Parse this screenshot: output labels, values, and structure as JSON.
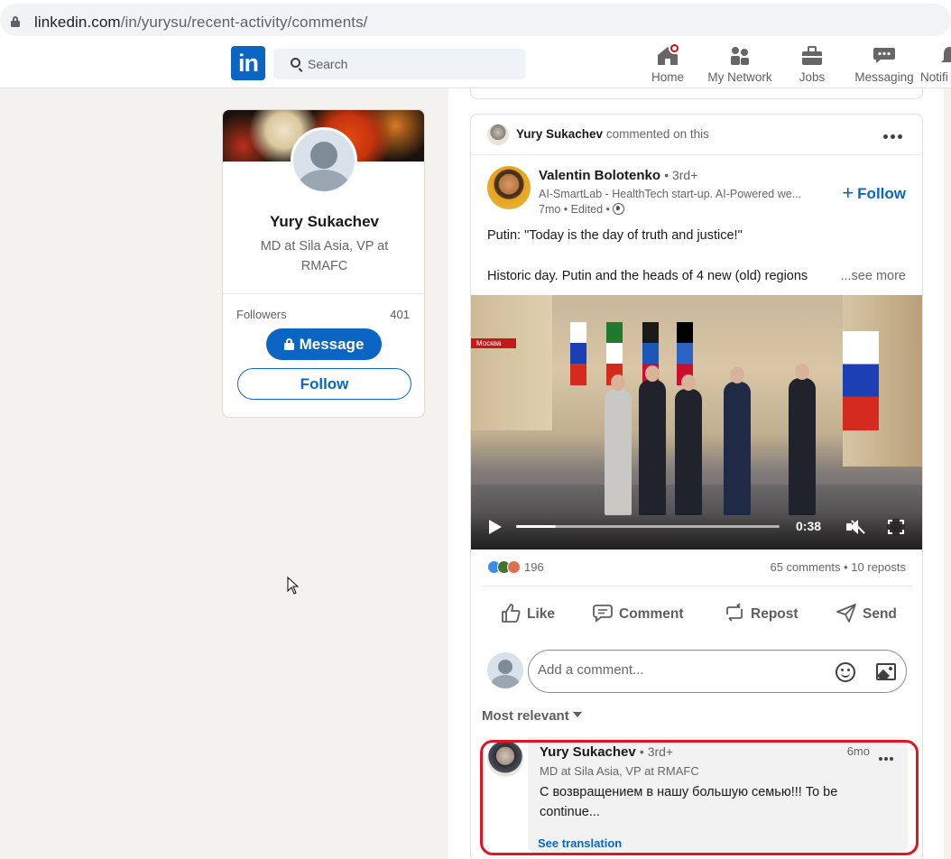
{
  "browser": {
    "url_host": "linkedin.com",
    "url_path": "/in/yurysu/recent-activity/comments/"
  },
  "nav": {
    "logo": "in",
    "search_placeholder": "Search",
    "items": [
      {
        "label": "Home",
        "icon": "home-icon",
        "badge": true
      },
      {
        "label": "My Network",
        "icon": "network-icon"
      },
      {
        "label": "Jobs",
        "icon": "briefcase-icon"
      },
      {
        "label": "Messaging",
        "icon": "messaging-icon"
      },
      {
        "label": "Notifi",
        "icon": "bell-icon"
      }
    ]
  },
  "profile_card": {
    "name": "Yury Sukachev",
    "title": "MD at Sila Asia, VP at RMAFC",
    "followers_label": "Followers",
    "followers_count": "401",
    "message_button": "Message",
    "follow_button": "Follow"
  },
  "post": {
    "activity_actor": "Yury Sukachev",
    "activity_text": "commented on this",
    "author_name": "Valentin Bolotenko",
    "author_degree": "• 3rd+",
    "author_headline": "AI-SmartLab - HealthTech start-up. AI-Powered we...",
    "author_meta": "7mo • Edited •",
    "follow_label": "Follow",
    "text_line1": "Putin: \"Today is the day of truth and justice!\"",
    "text_line2": "Historic day. Putin and the heads of 4 new (old) regions",
    "see_more": "...see more",
    "video": {
      "overlay_tag": "Москва",
      "time": "0:38",
      "progress": 0.15,
      "muted": true
    },
    "reactions_count": "196",
    "comments_reposts": "65 comments • 10 reposts",
    "actions": [
      "Like",
      "Comment",
      "Repost",
      "Send"
    ],
    "comment_placeholder": "Add a comment...",
    "sort_label": "Most relevant"
  },
  "comment": {
    "name": "Yury Sukachev",
    "degree": "• 3rd+",
    "time": "6mo",
    "headline": "MD at Sila Asia, VP at RMAFC",
    "text": "С возвращением в нашу большую семью!!! To be continue...",
    "translate_label": "See translation"
  },
  "colors": {
    "brand": "#0a66c2",
    "highlight": "#e01624"
  }
}
